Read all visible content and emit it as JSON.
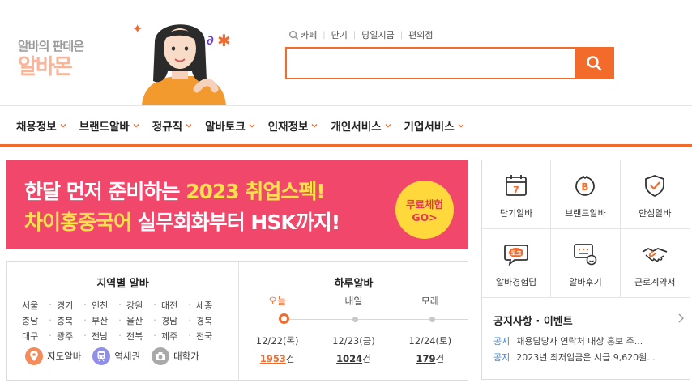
{
  "brand": {
    "logo_line1": "알바의 판테온",
    "logo_line2": "알바몬",
    "accent": "#f36b2b"
  },
  "quick_links": [
    "카페",
    "단기",
    "당일지급",
    "편의점"
  ],
  "search": {
    "value": "",
    "button_icon": "search-icon"
  },
  "nav": {
    "items": [
      {
        "label": "채용정보"
      },
      {
        "label": "브랜드알바"
      },
      {
        "label": "정규직"
      },
      {
        "label": "알바토크"
      },
      {
        "label": "인재정보"
      },
      {
        "label": "개인서비스"
      },
      {
        "label": "기업서비스"
      }
    ]
  },
  "banner": {
    "line1_a": "한달 먼저 준비하는 ",
    "line1_b": "2023 취업스펙!",
    "line2_a": "차이홍중국어",
    "line2_b": " 실무회화부터 HSK까지!",
    "cta_1": "무료체험",
    "cta_2": "GO>",
    "bg_color": "#f0476b"
  },
  "region": {
    "title": "지역별 알바",
    "rows": [
      [
        "서울",
        "경기",
        "인천",
        "강원",
        "대전",
        "세종"
      ],
      [
        "충남",
        "충북",
        "부산",
        "울산",
        "경남",
        "경북"
      ],
      [
        "대구",
        "광주",
        "전남",
        "전북",
        "제주",
        "전국"
      ]
    ],
    "shortcuts": [
      {
        "label": "지도알바",
        "icon": "map-pin-icon"
      },
      {
        "label": "역세권",
        "icon": "subway-icon"
      },
      {
        "label": "대학가",
        "icon": "campus-icon"
      }
    ]
  },
  "daily": {
    "title": "하루알바",
    "days": [
      {
        "label": "오늘",
        "date": "12/22(목)",
        "count": "1953",
        "unit": "건"
      },
      {
        "label": "내일",
        "date": "12/23(금)",
        "count": "1024",
        "unit": "건"
      },
      {
        "label": "모레",
        "date": "12/24(토)",
        "count": "179",
        "unit": "건"
      }
    ]
  },
  "services": [
    {
      "label": "단기알바",
      "icon": "calendar-7-icon"
    },
    {
      "label": "브랜드알바",
      "icon": "brand-b-icon"
    },
    {
      "label": "안심알바",
      "icon": "shield-check-icon"
    },
    {
      "label": "알바경험담",
      "icon": "talk-bubble-icon"
    },
    {
      "label": "알바후기",
      "icon": "review-icon"
    },
    {
      "label": "근로계약서",
      "icon": "handshake-icon"
    }
  ],
  "notice": {
    "title": "공지사항 · 이벤트",
    "items": [
      {
        "tag": "공지",
        "text": "채용담당자 연락처 대상 홍보 주..."
      },
      {
        "tag": "공지",
        "text": "2023년 최저임금은 시급 9,620원..."
      }
    ]
  }
}
